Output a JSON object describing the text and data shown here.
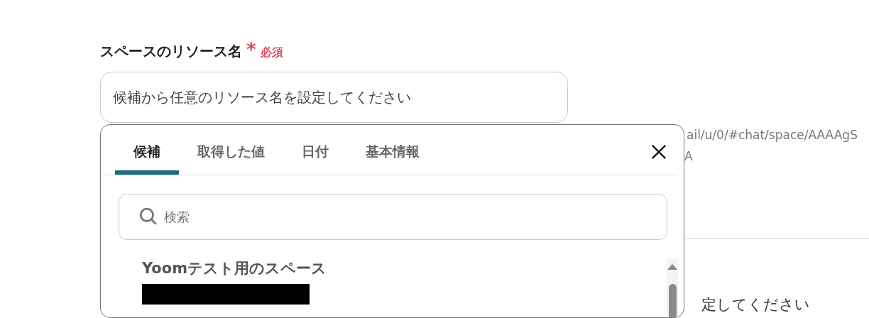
{
  "field": {
    "label": "スペースのリソース名",
    "required_mark": "*",
    "required_label": "必須",
    "placeholder": "候補から任意のリソース名を設定してください"
  },
  "background": {
    "url_line": "ail/u/0/#chat/space/AAAAgS",
    "url_line_2": "A",
    "next_placeholder": "定してください"
  },
  "dropdown": {
    "tabs": [
      {
        "label": "候補",
        "selected": true
      },
      {
        "label": "取得した値",
        "selected": false
      },
      {
        "label": "日付",
        "selected": false
      },
      {
        "label": "基本情報",
        "selected": false
      }
    ],
    "search": {
      "placeholder": "検索"
    },
    "options": [
      {
        "title": "Yoomテスト用のスペース",
        "redacted": true
      }
    ]
  }
}
